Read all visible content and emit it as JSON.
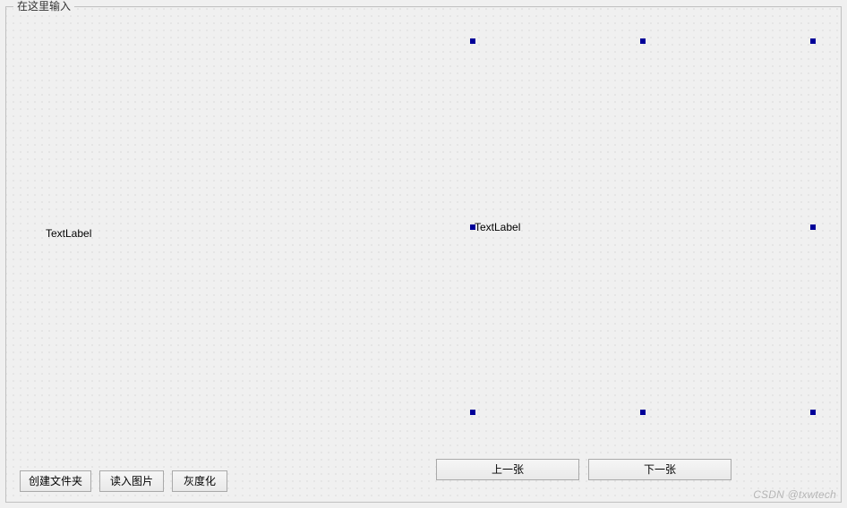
{
  "groupbox": {
    "title": "在这里输入"
  },
  "labels": {
    "left_text": "TextLabel",
    "right_text": "TextLabel"
  },
  "buttons": {
    "create_folder": "创建文件夹",
    "load_image": "读入图片",
    "grayscale": "灰度化",
    "prev_image": "上一张",
    "next_image": "下一张"
  },
  "watermark": "CSDN @txwtech"
}
